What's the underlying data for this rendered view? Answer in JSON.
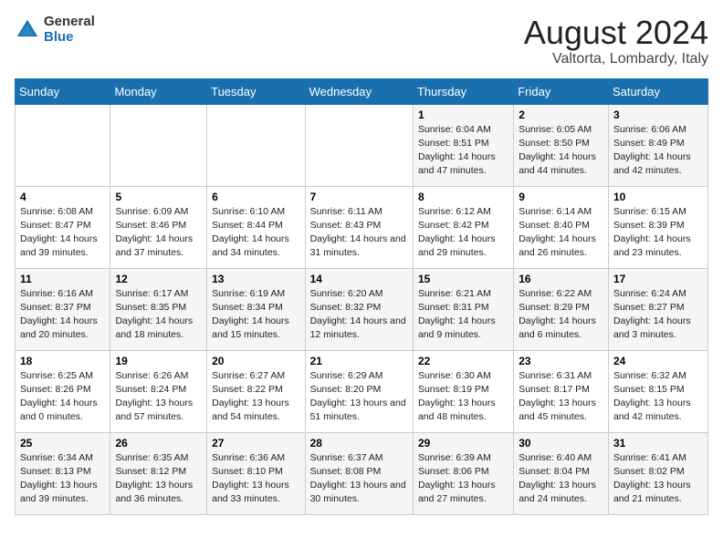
{
  "logo": {
    "general": "General",
    "blue": "Blue"
  },
  "title": "August 2024",
  "subtitle": "Valtorta, Lombardy, Italy",
  "days_of_week": [
    "Sunday",
    "Monday",
    "Tuesday",
    "Wednesday",
    "Thursday",
    "Friday",
    "Saturday"
  ],
  "weeks": [
    [
      {
        "day": "",
        "info": ""
      },
      {
        "day": "",
        "info": ""
      },
      {
        "day": "",
        "info": ""
      },
      {
        "day": "",
        "info": ""
      },
      {
        "day": "1",
        "info": "Sunrise: 6:04 AM\nSunset: 8:51 PM\nDaylight: 14 hours and 47 minutes."
      },
      {
        "day": "2",
        "info": "Sunrise: 6:05 AM\nSunset: 8:50 PM\nDaylight: 14 hours and 44 minutes."
      },
      {
        "day": "3",
        "info": "Sunrise: 6:06 AM\nSunset: 8:49 PM\nDaylight: 14 hours and 42 minutes."
      }
    ],
    [
      {
        "day": "4",
        "info": "Sunrise: 6:08 AM\nSunset: 8:47 PM\nDaylight: 14 hours and 39 minutes."
      },
      {
        "day": "5",
        "info": "Sunrise: 6:09 AM\nSunset: 8:46 PM\nDaylight: 14 hours and 37 minutes."
      },
      {
        "day": "6",
        "info": "Sunrise: 6:10 AM\nSunset: 8:44 PM\nDaylight: 14 hours and 34 minutes."
      },
      {
        "day": "7",
        "info": "Sunrise: 6:11 AM\nSunset: 8:43 PM\nDaylight: 14 hours and 31 minutes."
      },
      {
        "day": "8",
        "info": "Sunrise: 6:12 AM\nSunset: 8:42 PM\nDaylight: 14 hours and 29 minutes."
      },
      {
        "day": "9",
        "info": "Sunrise: 6:14 AM\nSunset: 8:40 PM\nDaylight: 14 hours and 26 minutes."
      },
      {
        "day": "10",
        "info": "Sunrise: 6:15 AM\nSunset: 8:39 PM\nDaylight: 14 hours and 23 minutes."
      }
    ],
    [
      {
        "day": "11",
        "info": "Sunrise: 6:16 AM\nSunset: 8:37 PM\nDaylight: 14 hours and 20 minutes."
      },
      {
        "day": "12",
        "info": "Sunrise: 6:17 AM\nSunset: 8:35 PM\nDaylight: 14 hours and 18 minutes."
      },
      {
        "day": "13",
        "info": "Sunrise: 6:19 AM\nSunset: 8:34 PM\nDaylight: 14 hours and 15 minutes."
      },
      {
        "day": "14",
        "info": "Sunrise: 6:20 AM\nSunset: 8:32 PM\nDaylight: 14 hours and 12 minutes."
      },
      {
        "day": "15",
        "info": "Sunrise: 6:21 AM\nSunset: 8:31 PM\nDaylight: 14 hours and 9 minutes."
      },
      {
        "day": "16",
        "info": "Sunrise: 6:22 AM\nSunset: 8:29 PM\nDaylight: 14 hours and 6 minutes."
      },
      {
        "day": "17",
        "info": "Sunrise: 6:24 AM\nSunset: 8:27 PM\nDaylight: 14 hours and 3 minutes."
      }
    ],
    [
      {
        "day": "18",
        "info": "Sunrise: 6:25 AM\nSunset: 8:26 PM\nDaylight: 14 hours and 0 minutes."
      },
      {
        "day": "19",
        "info": "Sunrise: 6:26 AM\nSunset: 8:24 PM\nDaylight: 13 hours and 57 minutes."
      },
      {
        "day": "20",
        "info": "Sunrise: 6:27 AM\nSunset: 8:22 PM\nDaylight: 13 hours and 54 minutes."
      },
      {
        "day": "21",
        "info": "Sunrise: 6:29 AM\nSunset: 8:20 PM\nDaylight: 13 hours and 51 minutes."
      },
      {
        "day": "22",
        "info": "Sunrise: 6:30 AM\nSunset: 8:19 PM\nDaylight: 13 hours and 48 minutes."
      },
      {
        "day": "23",
        "info": "Sunrise: 6:31 AM\nSunset: 8:17 PM\nDaylight: 13 hours and 45 minutes."
      },
      {
        "day": "24",
        "info": "Sunrise: 6:32 AM\nSunset: 8:15 PM\nDaylight: 13 hours and 42 minutes."
      }
    ],
    [
      {
        "day": "25",
        "info": "Sunrise: 6:34 AM\nSunset: 8:13 PM\nDaylight: 13 hours and 39 minutes."
      },
      {
        "day": "26",
        "info": "Sunrise: 6:35 AM\nSunset: 8:12 PM\nDaylight: 13 hours and 36 minutes."
      },
      {
        "day": "27",
        "info": "Sunrise: 6:36 AM\nSunset: 8:10 PM\nDaylight: 13 hours and 33 minutes."
      },
      {
        "day": "28",
        "info": "Sunrise: 6:37 AM\nSunset: 8:08 PM\nDaylight: 13 hours and 30 minutes."
      },
      {
        "day": "29",
        "info": "Sunrise: 6:39 AM\nSunset: 8:06 PM\nDaylight: 13 hours and 27 minutes."
      },
      {
        "day": "30",
        "info": "Sunrise: 6:40 AM\nSunset: 8:04 PM\nDaylight: 13 hours and 24 minutes."
      },
      {
        "day": "31",
        "info": "Sunrise: 6:41 AM\nSunset: 8:02 PM\nDaylight: 13 hours and 21 minutes."
      }
    ]
  ]
}
